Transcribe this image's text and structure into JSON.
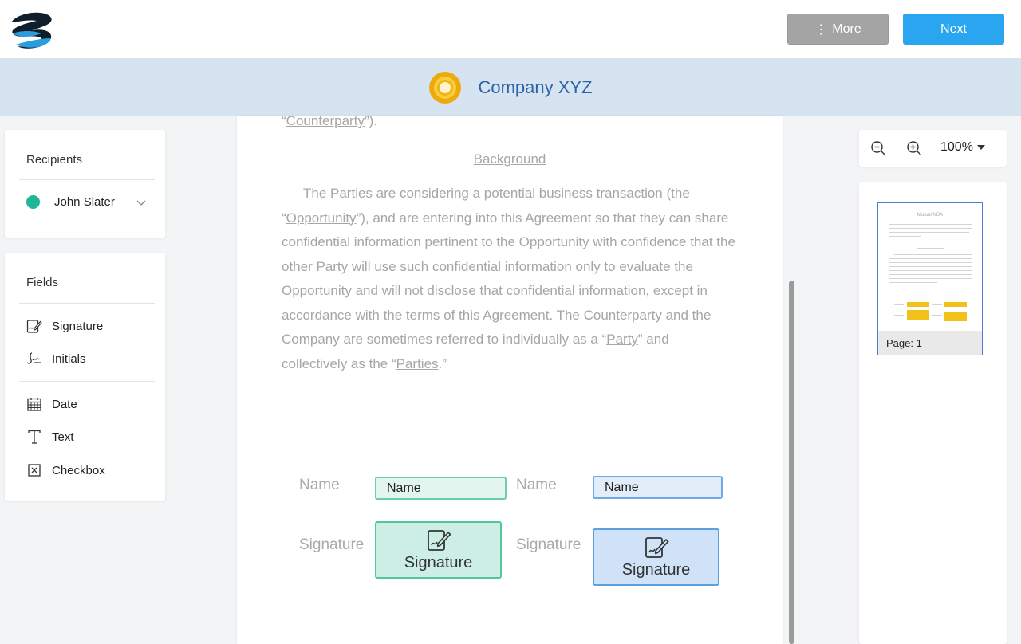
{
  "topbar": {
    "more_label": "More",
    "next_label": "Next"
  },
  "company": {
    "name": "Company XYZ"
  },
  "recipients": {
    "title": "Recipients",
    "items": [
      {
        "name": "John Slater",
        "color": "#1fb597"
      }
    ]
  },
  "fields": {
    "title": "Fields",
    "items": [
      {
        "label": "Signature",
        "icon": "signature-icon"
      },
      {
        "label": "Initials",
        "icon": "initials-icon"
      },
      {
        "label": "Date",
        "icon": "calendar-icon"
      },
      {
        "label": "Text",
        "icon": "text-icon"
      },
      {
        "label": "Checkbox",
        "icon": "checkbox-icon"
      }
    ]
  },
  "document": {
    "top_open": "“",
    "top_term": "Counterparty",
    "top_close": "”).",
    "heading": "Background",
    "para": {
      "p1": "The Parties are considering a potential business transaction (the “",
      "t1": "Opportunity",
      "p2": "”), and are entering into this Agreement so that they can share confidential information pertinent to the Opportunity with confidence that the other Party will use such confidential information only to evaluate the Opportunity and will not disclose that confidential information, except in accordance with the terms of this Agreement. The Counterparty and the Company are sometimes referred to individually as a “",
      "t2": "Party",
      "p3": "” and collectively as the “",
      "t3": "Parties",
      "p4": ".”"
    },
    "signers": [
      {
        "name_label": "Name",
        "name_field": "Name",
        "signature_label": "Signature",
        "signature_field": "Signature",
        "color": "#52c6a2"
      },
      {
        "name_label": "Name",
        "name_field": "Name",
        "signature_label": "Signature",
        "signature_field": "Signature",
        "color": "#5aa0df"
      }
    ]
  },
  "zoom": {
    "level": "100%"
  },
  "thumbnail": {
    "title": "Mutual NDA",
    "caption": "Page: 1",
    "highlight_color": "#f2c21b"
  }
}
